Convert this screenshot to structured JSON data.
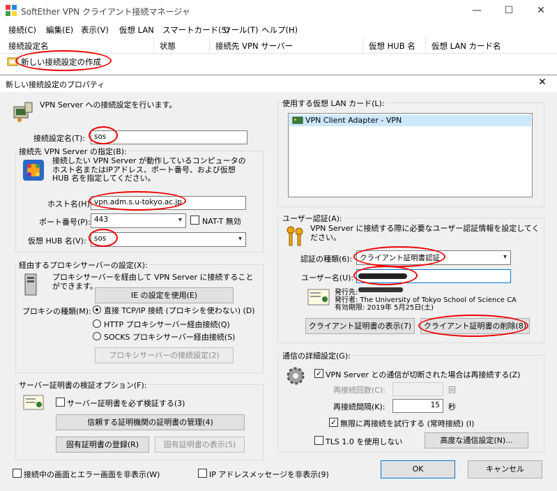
{
  "main_window": {
    "title": "SoftEther VPN クライアント接続マネージャ",
    "controls": {
      "minimize": "—",
      "maximize": "☐",
      "close": "✕"
    },
    "menu": [
      "接続(C)",
      "編集(E)",
      "表示(V)",
      "仮想 LAN",
      "スマートカード(S)",
      "ツール(T)",
      "ヘルプ(H)"
    ],
    "columns": [
      "接続設定名",
      "状態",
      "接続先 VPN サーバー",
      "仮想 HUB 名",
      "仮想 LAN カード名"
    ],
    "rows": [
      "新しい接続設定の作成"
    ]
  },
  "dialog": {
    "title": "新しい接続設定のプロパティ",
    "close": "✕",
    "intro": "VPN Server への接続設定を行います。",
    "setting_name_label": "接続設定名(T):",
    "setting_name_value": "sos",
    "server_group": {
      "label": "接続先 VPN Server の指定(B):",
      "description": "接続したい VPN Server が動作しているコンピュータのホスト名またはIPアドレス、ポート番号、および仮想 HUB 名を指定してください。",
      "host_label": "ホスト名(H):",
      "host_value": "vpn.adm.s.u-tokyo.ac.jp",
      "port_label": "ポート番号(P):",
      "port_value": "443",
      "natt_label": "NAT-T 無効",
      "hub_label": "仮想 HUB 名(V):",
      "hub_value": "sos"
    },
    "proxy_group": {
      "label": "経由するプロキシサーバーの設定(X):",
      "description": "プロキシサーバーを経由して VPN Server に接続することができます。",
      "ie_button": "IE の設定を使用(E)",
      "type_label": "プロキシの種類(M):",
      "options": [
        "直接 TCP/IP 接続 (プロキシを使わない) (D)",
        "HTTP プロキシサーバー経由接続(Q)",
        "SOCKS プロキシサーバー経由接続(S)"
      ],
      "selected": 0,
      "proxy_button": "プロキシサーバーの接続設定(2)"
    },
    "cert_group": {
      "label": "サーバー証明書の検証オプション(F):",
      "verify_label": "サーバー証明書を必ず検証する(3)",
      "manage_button": "信頼する証明機関の証明書の管理(4)",
      "register_button": "固有証明書の登録(R)",
      "show_button": "固有証明書の表示(5)"
    },
    "hide_status_label": "接続中の画面とエラー画面を非表示(W)",
    "vlan_group": {
      "label": "使用する仮想 LAN カード(L):",
      "items": [
        "VPN Client Adapter - VPN"
      ]
    },
    "auth_group": {
      "label": "ユーザー認証(A):",
      "description": "VPN Server に接続する際に必要なユーザー認証情報を設定してください。",
      "type_label": "認証の種類(6):",
      "type_value": "クライアント証明書認証",
      "user_label": "ユーザー名(U):",
      "user_value": "",
      "issued_to_label": "発行先:",
      "issued_by": "発行者: The University of Tokyo School of Science CA",
      "expires": "有効期限: 2019年 5月25日(土)",
      "show_cert_button": "クライアント証明書の表示(7)",
      "delete_cert_button": "クライアント証明書の削除(8)"
    },
    "advanced_group": {
      "label": "通信の詳細設定(G):",
      "reconnect_label": "VPN Server との通信が切断された場合は再接続する(Z)",
      "retry_count_label": "再接続回数(C):",
      "retry_count_unit": "回",
      "interval_label": "再接続間隔(K):",
      "interval_value": "15",
      "interval_unit": "秒",
      "infinite_label": "無限に再接続を試行する (常時接続) (I)",
      "tls_label": "TLS 1.0 を使用しない",
      "advanced_button": "高度な通信設定(N)..."
    },
    "hide_ip_label": "IP アドレスメッセージを非表示(9)",
    "ok": "OK",
    "cancel": "キャンセル"
  }
}
